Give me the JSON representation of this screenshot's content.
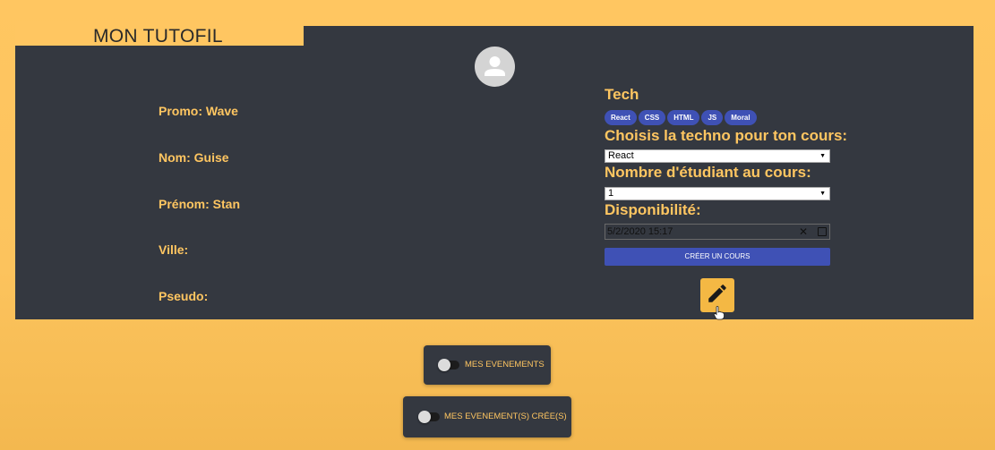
{
  "header": {
    "title": "MON TUTOFIL"
  },
  "profile": {
    "avatar_icon": "person-avatar-icon",
    "fields": [
      {
        "label": "Promo: Wave"
      },
      {
        "label": "Nom: Guise"
      },
      {
        "label": "Prénom: Stan"
      },
      {
        "label": "Ville:"
      },
      {
        "label": "Pseudo:"
      }
    ]
  },
  "course_form": {
    "tech_title": "Tech",
    "tech_chips": [
      "React",
      "CSS",
      "HTML",
      "JS",
      "Moral"
    ],
    "techno_label": "Choisis la techno pour ton cours:",
    "techno_value": "React",
    "students_label": "Nombre d'étudiant au cours:",
    "students_value": "1",
    "availability_label": "Disponibilité:",
    "availability_value": "5/2/2020 15:17",
    "create_button": "CRÉER UN COURS",
    "edit_icon": "pencil-icon"
  },
  "toggles": {
    "events_label": "MES EVENEMENTS",
    "created_events_label": "MES EVENEMENT(S) CRÉE(S)"
  },
  "colors": {
    "background": "#ffc661",
    "panel": "#343840",
    "accent": "#3f51b5",
    "label": "#ffc661"
  }
}
